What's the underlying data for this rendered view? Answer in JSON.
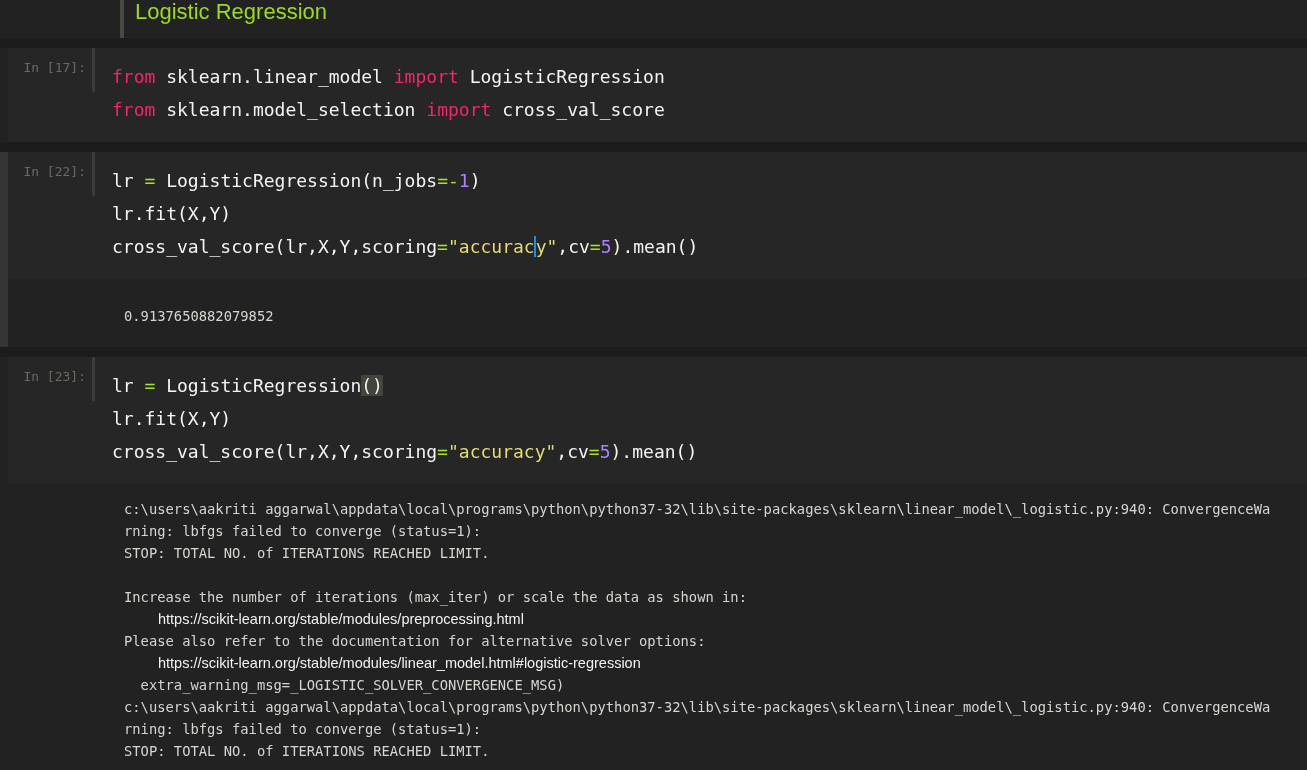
{
  "heading": "Logistic Regression",
  "cells": [
    {
      "prompt": "In [17]:",
      "selected": false,
      "lines": [
        [
          {
            "t": "from",
            "kind": "keyword"
          },
          {
            "t": " sklearn.linear_model ",
            "kind": "plain"
          },
          {
            "t": "import",
            "kind": "keyword"
          },
          {
            "t": " LogisticRegression",
            "kind": "plain"
          }
        ],
        [
          {
            "t": "from",
            "kind": "keyword"
          },
          {
            "t": " sklearn.model_selection ",
            "kind": "plain"
          },
          {
            "t": "import",
            "kind": "keyword"
          },
          {
            "t": " cross_val_score",
            "kind": "plain"
          }
        ]
      ]
    },
    {
      "prompt": "In [22]:",
      "selected": true,
      "lines": [
        [
          {
            "t": "lr ",
            "kind": "plain"
          },
          {
            "t": "=",
            "kind": "operator"
          },
          {
            "t": " LogisticRegression(n_jobs",
            "kind": "plain"
          },
          {
            "t": "=-",
            "kind": "operator"
          },
          {
            "t": "1",
            "kind": "number"
          },
          {
            "t": ")",
            "kind": "plain"
          }
        ],
        [
          {
            "t": "lr.fit(X,Y)",
            "kind": "plain"
          }
        ],
        [
          {
            "t": "cross_val_score(lr,X,Y,scoring",
            "kind": "plain"
          },
          {
            "t": "=",
            "kind": "operator"
          },
          {
            "t": "\"accurac",
            "kind": "string"
          },
          {
            "t": "y\"",
            "kind": "string",
            "cursor": true
          },
          {
            "t": ",cv",
            "kind": "plain"
          },
          {
            "t": "=",
            "kind": "operator"
          },
          {
            "t": "5",
            "kind": "number"
          },
          {
            "t": ").mean()",
            "kind": "plain"
          }
        ]
      ],
      "output": [
        {
          "kind": "result",
          "text": "0.9137650882079852"
        }
      ]
    },
    {
      "prompt": "In [23]:",
      "selected": false,
      "lines": [
        [
          {
            "t": "lr ",
            "kind": "plain"
          },
          {
            "t": "=",
            "kind": "operator"
          },
          {
            "t": " LogisticRegression",
            "kind": "plain"
          },
          {
            "t": "()",
            "kind": "plain",
            "matched": true
          }
        ],
        [
          {
            "t": "lr.fit(X,Y)",
            "kind": "plain"
          }
        ],
        [
          {
            "t": "cross_val_score(lr,X,Y,scoring",
            "kind": "plain"
          },
          {
            "t": "=",
            "kind": "operator"
          },
          {
            "t": "\"accuracy\"",
            "kind": "string"
          },
          {
            "t": ",cv",
            "kind": "plain"
          },
          {
            "t": "=",
            "kind": "operator"
          },
          {
            "t": "5",
            "kind": "number"
          },
          {
            "t": ").mean()",
            "kind": "plain"
          }
        ]
      ],
      "output": [
        {
          "kind": "stream",
          "text": "c:\\users\\aakriti aggarwal\\appdata\\local\\programs\\python\\python37-32\\lib\\site-packages\\sklearn\\linear_model\\_logistic.py:940: ConvergenceWa"
        },
        {
          "kind": "stream",
          "text": "rning: lbfgs failed to converge (status=1):"
        },
        {
          "kind": "stream",
          "text": "STOP: TOTAL NO. of ITERATIONS REACHED LIMIT."
        },
        {
          "kind": "blank"
        },
        {
          "kind": "stream",
          "text": "Increase the number of iterations (max_iter) or scale the data as shown in:"
        },
        {
          "kind": "url",
          "text": "https://scikit-learn.org/stable/modules/preprocessing.html"
        },
        {
          "kind": "stream",
          "text": "Please also refer to the documentation for alternative solver options:"
        },
        {
          "kind": "url",
          "text": "https://scikit-learn.org/stable/modules/linear_model.html#logistic-regression"
        },
        {
          "kind": "stream",
          "text": "  extra_warning_msg=_LOGISTIC_SOLVER_CONVERGENCE_MSG)"
        },
        {
          "kind": "stream",
          "text": "c:\\users\\aakriti aggarwal\\appdata\\local\\programs\\python\\python37-32\\lib\\site-packages\\sklearn\\linear_model\\_logistic.py:940: ConvergenceWa"
        },
        {
          "kind": "stream",
          "text": "rning: lbfgs failed to converge (status=1):"
        },
        {
          "kind": "stream",
          "text": "STOP: TOTAL NO. of ITERATIONS REACHED LIMIT."
        }
      ]
    }
  ]
}
